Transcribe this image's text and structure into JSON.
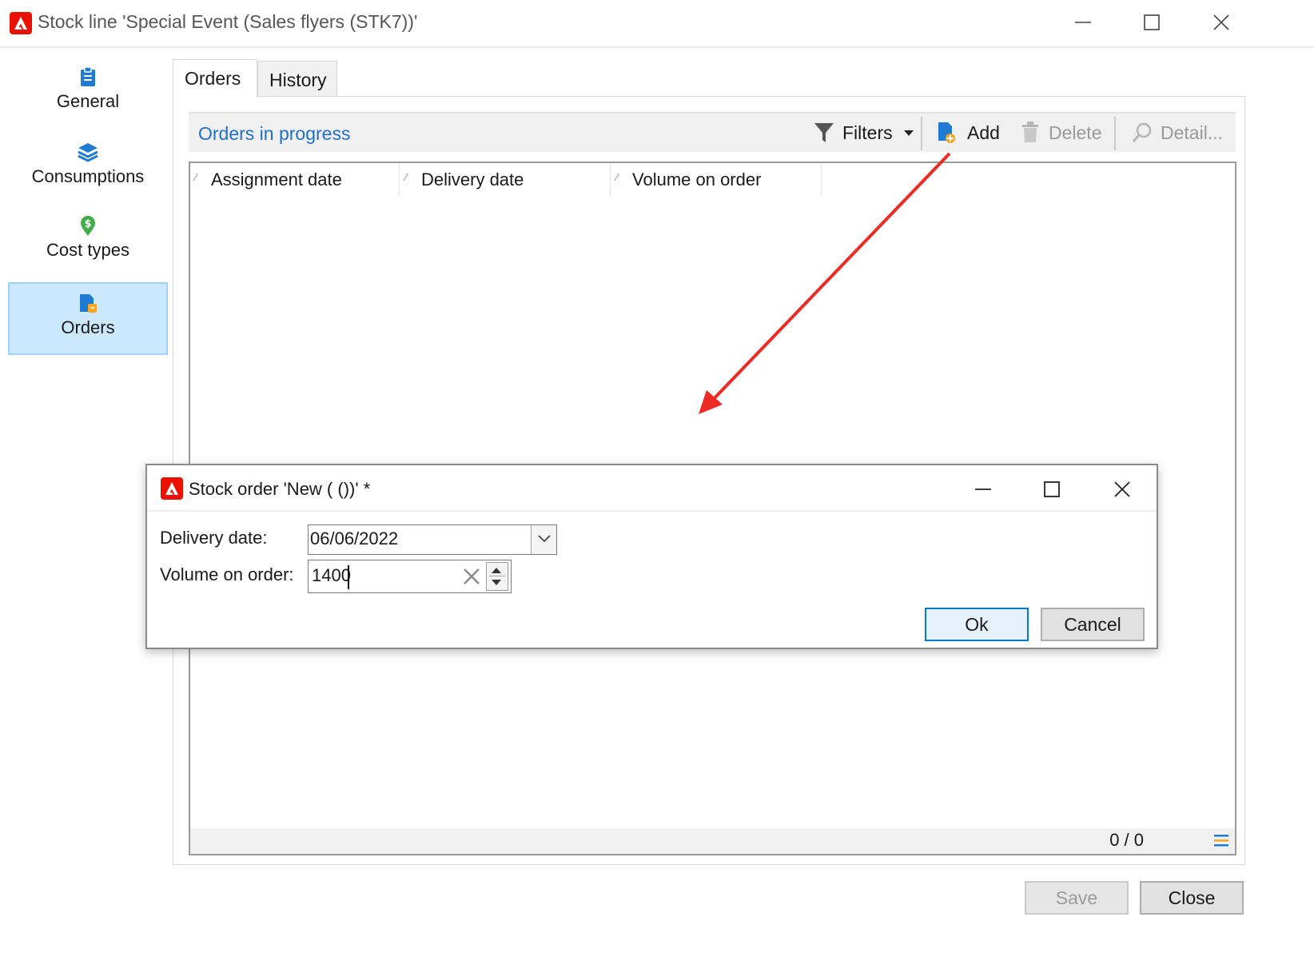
{
  "window": {
    "title": "Stock line 'Special Event (Sales flyers (STK7))'"
  },
  "sidebar": {
    "items": [
      {
        "label": "General",
        "icon": "clipboard-icon"
      },
      {
        "label": "Consumptions",
        "icon": "layers-icon"
      },
      {
        "label": "Cost types",
        "icon": "dollar-pin-icon"
      },
      {
        "label": "Orders",
        "icon": "orders-icon",
        "selected": true
      }
    ]
  },
  "tabs": [
    {
      "label": "Orders",
      "selected": true
    },
    {
      "label": "History",
      "selected": false
    }
  ],
  "toolbar": {
    "section_title": "Orders in progress",
    "filters_label": "Filters",
    "add_label": "Add",
    "delete_label": "Delete",
    "detail_label": "Detail..."
  },
  "list": {
    "columns": [
      "Assignment date",
      "Delivery date",
      "Volume on order"
    ],
    "rows": [],
    "counter": "0 / 0"
  },
  "dialog": {
    "title": "Stock order 'New ( ())' *",
    "delivery_date_label": "Delivery date:",
    "delivery_date_value": "06/06/2022",
    "volume_label": "Volume on order:",
    "volume_value": "1400",
    "ok_label": "Ok",
    "cancel_label": "Cancel"
  },
  "footer": {
    "save_label": "Save",
    "close_label": "Close"
  },
  "colors": {
    "brand": "#eb1000",
    "link": "#1f6fd0",
    "selection": "#cce8ff",
    "annotation_arrow": "#ee2a24"
  }
}
